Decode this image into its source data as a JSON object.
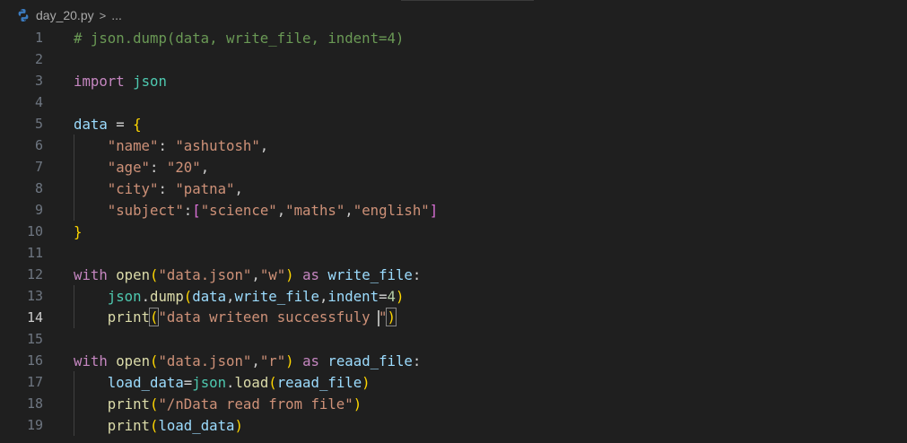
{
  "breadcrumb": {
    "file_name": "day_20.py",
    "separator": ">",
    "rest": "...",
    "icon": "python-icon"
  },
  "editor": {
    "active_line": 14,
    "line_numbers": [
      "1",
      "2",
      "3",
      "4",
      "5",
      "6",
      "7",
      "8",
      "9",
      "10",
      "11",
      "12",
      "13",
      "14",
      "15",
      "16",
      "17",
      "18",
      "19"
    ],
    "lines": [
      "# json.dump(data, write_file, indent=4)",
      "",
      "import json",
      "",
      "data = {",
      "    \"name\": \"ashutosh\",",
      "    \"age\": \"20\",",
      "    \"city\": \"patna\",",
      "    \"subject\":[\"science\",\"maths\",\"english\"]",
      "}",
      "",
      "with open(\"data.json\",\"w\") as write_file:",
      "    json.dump(data,write_file,indent=4)",
      "    print(\"data writeen successfuly \")",
      "",
      "with open(\"data.json\",\"r\") as reaad_file:",
      "    load_data=json.load(reaad_file)",
      "    print(\"/nData read from file\")",
      "    print(load_data)"
    ]
  },
  "colors": {
    "background": "#1f1f1f",
    "comment": "#6a9955",
    "keyword": "#c586c0",
    "string": "#ce9178",
    "variable": "#9cdcfe",
    "function": "#dcdcaa",
    "module": "#4ec9b0",
    "number": "#b5cea8"
  }
}
